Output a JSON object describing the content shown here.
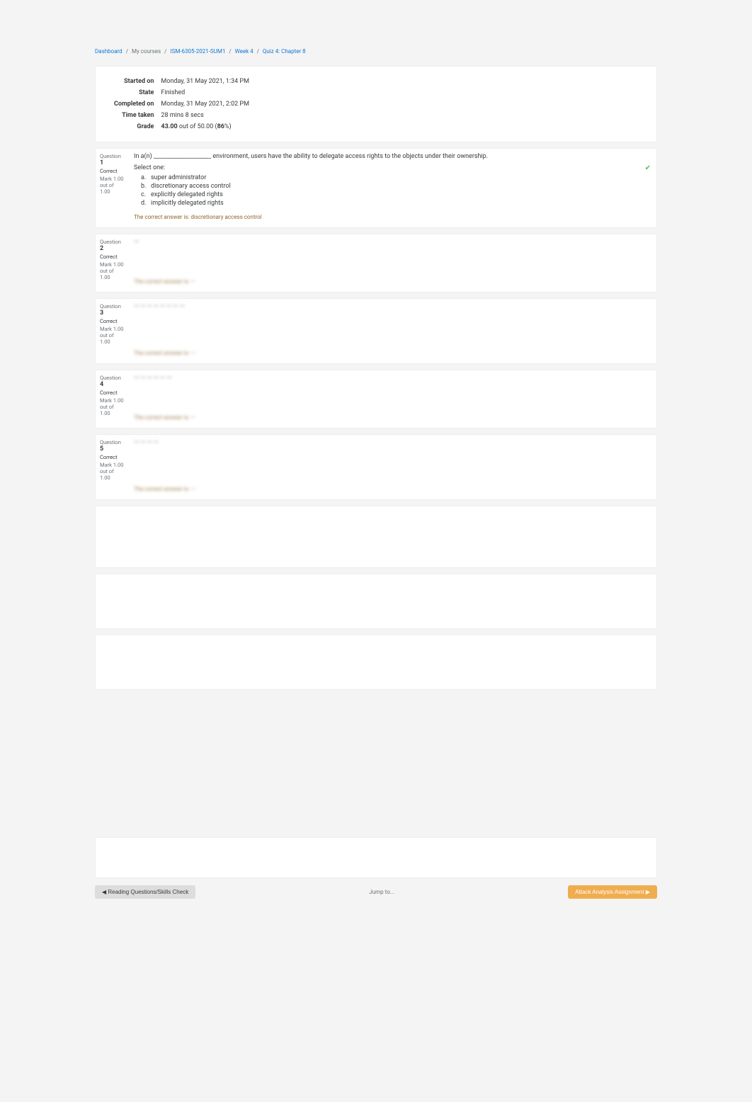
{
  "breadcrumb": {
    "dashboard": "Dashboard",
    "mycourses": "My courses",
    "course": "ISM-6305-2021-SUM1",
    "week": "Week 4",
    "quiz": "Quiz 4: Chapter 8"
  },
  "summary": {
    "started_label": "Started on",
    "started_value": "Monday, 31 May 2021, 1:34 PM",
    "state_label": "State",
    "state_value": "Finished",
    "completed_label": "Completed on",
    "completed_value": "Monday, 31 May 2021, 2:02 PM",
    "timetaken_label": "Time taken",
    "timetaken_value": "28 mins 8 secs",
    "grade_label": "Grade",
    "grade_value_pre": "43.00",
    "grade_value_mid": " out of 50.00 (",
    "grade_value_pct": "86",
    "grade_value_suf": "%)"
  },
  "question_label": "Question ",
  "correct_label": "Correct",
  "mark_label": "Mark 1.00 out of 1.00",
  "select_one": "Select one:",
  "correct_answer_prefix": "The correct answer is: ",
  "q1": {
    "num": "1",
    "text": "In a(n) ____________________ environment, users have the ability to delegate access rights to the objects under their ownership.",
    "opts": {
      "a": "a.",
      "a_text": "super administrator",
      "b": "b.",
      "b_text": "discretionary access control",
      "c": "c.",
      "c_text": "explicitly delegated rights",
      "d": "d.",
      "d_text": "implicitly delegated rights"
    },
    "correct": "discretionary access control"
  },
  "q2": {
    "num": "2",
    "text": "—",
    "correct": "—"
  },
  "q3": {
    "num": "3",
    "text": "— — — — — — — —",
    "correct": "—"
  },
  "q4": {
    "num": "4",
    "text": "— — — — — —",
    "correct": "—"
  },
  "q5": {
    "num": "5",
    "text": "— — — —",
    "correct": "—"
  },
  "nav": {
    "prev": "◀ Reading Questions/Skills Check",
    "jump": "Jump to...",
    "next": "Attack Analysis Assignment ▶"
  }
}
